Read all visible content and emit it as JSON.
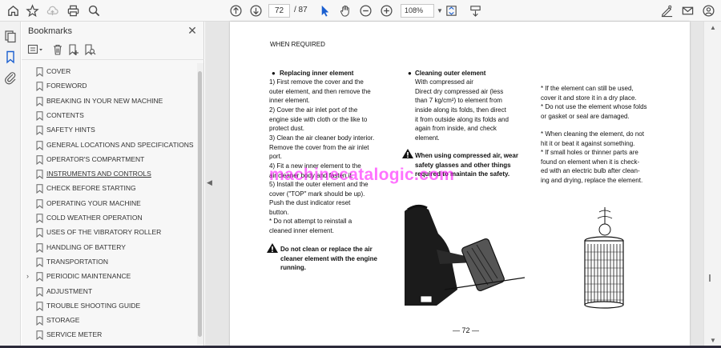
{
  "toolbar": {
    "page_current": "72",
    "page_total": "/ 87",
    "zoom": "108%",
    "icons": [
      "home-icon",
      "star-icon",
      "upload-icon",
      "print-icon",
      "zoom-icon",
      "prev-page-icon",
      "next-page-icon",
      "select-icon",
      "hand-icon",
      "zoom-out-icon",
      "zoom-in-icon",
      "fit-page-icon",
      "scroll-mode-icon",
      "sign-icon",
      "email-icon",
      "account-icon"
    ]
  },
  "bookmarks": {
    "title": "Bookmarks",
    "close": "✕",
    "items": [
      {
        "label": "COVER"
      },
      {
        "label": "FOREWORD"
      },
      {
        "label": "BREAKING IN YOUR NEW MACHINE"
      },
      {
        "label": "CONTENTS"
      },
      {
        "label": "SAFETY HINTS"
      },
      {
        "label": "GENERAL LOCATIONS AND SPECIFICATIONS"
      },
      {
        "label": "OPERATOR'S COMPARTMENT"
      },
      {
        "label": "INSTRUMENTS AND CONTROLS"
      },
      {
        "label": "CHECK BEFORE STARTING"
      },
      {
        "label": "OPERATING YOUR MACHINE"
      },
      {
        "label": "COLD WEATHER OPERATION"
      },
      {
        "label": "USES OF THE VIBRATORY ROLLER"
      },
      {
        "label": "HANDLING OF BATTERY"
      },
      {
        "label": "TRANSPORTATION"
      },
      {
        "label": "PERIODIC MAINTENANCE"
      },
      {
        "label": "ADJUSTMENT"
      },
      {
        "label": "TROUBLE SHOOTING GUIDE"
      },
      {
        "label": "STORAGE"
      },
      {
        "label": "SERVICE METER"
      }
    ]
  },
  "document": {
    "header": "WHEN REQUIRED",
    "col1": {
      "heading": "Replacing inner element",
      "lines": [
        "1)  First   remove   the   cover   and   the",
        "     outer element, and then remove the",
        "     inner element.",
        "2)  Cover  the  air  inlet  port  of  the",
        "     engine side with cloth or the like to",
        "     protect dust.",
        "3)  Clean  the  air  cleaner  body  interior.",
        "     Remove the cover from the air inlet",
        "     port.",
        "4)  Fit  a  new  inner  element  to  the",
        "     air cleaner body and fasten it.",
        "5)  Install  the  outer  element  and  the",
        "     cover  (\"TOP\"  mark  should  be  up).",
        "     Push   the   dust   indicator   reset",
        "     button.",
        "*    Do   not   attempt   to   reinstall   a",
        "     cleaned inner element."
      ],
      "warning": [
        "Do  not  clean  or  replace  the  air",
        "cleaner  element  with  the  engine",
        "running."
      ]
    },
    "col2": {
      "heading": "Cleaning outer element",
      "lines": [
        "With compressed air",
        "Direct   dry   compressed   air   (less",
        "than   7 kg/cm²)  to  element  from",
        "inside  along  its  folds,  then  direct",
        "it  from  outside  along  its  folds  and",
        "again   from   inside,   and   check",
        "element."
      ],
      "warning": [
        "When  using  compressed  air,  wear",
        "safety  glasses  and  other  things",
        "required to maintain the safety."
      ]
    },
    "col3": {
      "lines": [
        "*  If  the  element  can  still  be  used,",
        "    cover it and store it in a dry place.",
        "*  Do  not use the element whose folds",
        "    or gasket or seal are damaged.",
        "",
        "*  When  cleaning  the  element,  do  not",
        "    hit it or beat it against something.",
        "*  If  small  holes  or  thinner  parts  are",
        "    found on element when it is check-",
        "    ed with an electric bulb after clean-",
        "    ing and drying, replace the element."
      ]
    },
    "watermark": "machinecatalogic.com",
    "page_number": "— 72 —"
  },
  "colors": {
    "watermark": "#ff00ff",
    "accent": "#1a5fd0"
  }
}
